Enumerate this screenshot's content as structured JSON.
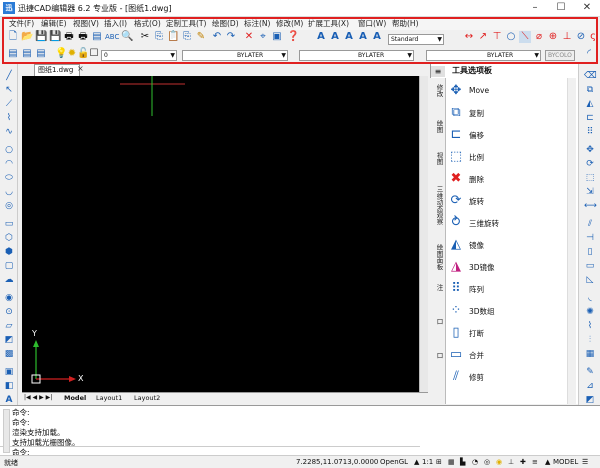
{
  "window": {
    "title": "迅捷CAD编辑器 6.2 专业版 - [图纸1.dwg]",
    "app_icon": "迅",
    "minimize": "–",
    "maximize": "☐",
    "close": "✕"
  },
  "menu": [
    "文件(F)",
    "编辑(E)",
    "视图(V)",
    "插入(I)",
    "格式(O)",
    "定制工具(T)",
    "绘图(D)",
    "标注(N)",
    "修改(M)",
    "扩展工具(X)",
    "窗口(W)",
    "帮助(H)"
  ],
  "toolbar": {
    "text_style": "Standard",
    "layer": "0",
    "color": "BYLATER",
    "linetype": "BYLATER",
    "lineweight": "BYLATER",
    "plotstyle": "BYCOLO"
  },
  "document": {
    "tab_label": "图纸1.dwg",
    "close": "×"
  },
  "axes": {
    "y_label": "Y",
    "x_label": "X"
  },
  "layout_tabs": [
    "Model",
    "Layout1",
    "Layout2"
  ],
  "palette": {
    "title": "工具选项板",
    "tabs": [
      "修改",
      "绘图",
      "视图",
      "三维动态观察",
      "绘图面板",
      "注",
      "口",
      "口"
    ],
    "items": [
      {
        "label": "Move",
        "icon": "move-icon"
      },
      {
        "label": "复制",
        "icon": "copy-icon"
      },
      {
        "label": "偏移",
        "icon": "offset-icon"
      },
      {
        "label": "比例",
        "icon": "scale-icon"
      },
      {
        "label": "删除",
        "icon": "delete-icon"
      },
      {
        "label": "旋转",
        "icon": "rotate-icon"
      },
      {
        "label": "三维旋转",
        "icon": "rotate3d-icon"
      },
      {
        "label": "镜像",
        "icon": "mirror-icon"
      },
      {
        "label": "3D镜像",
        "icon": "mirror3d-icon"
      },
      {
        "label": "阵列",
        "icon": "array-icon"
      },
      {
        "label": "3D数组",
        "icon": "array3d-icon"
      },
      {
        "label": "打断",
        "icon": "break-icon"
      },
      {
        "label": "合并",
        "icon": "join-icon"
      },
      {
        "label": "修剪",
        "icon": "trim-icon"
      }
    ]
  },
  "command": {
    "lines": [
      "命令:",
      "命令:",
      "渲染支持加载。",
      "支持加载光栅图像。"
    ],
    "prompt": "命令:"
  },
  "status": {
    "left": "就绪",
    "coords": "7.2285,11.0713,0.0000",
    "opengl": "OpenGL",
    "scale": "1:1",
    "model": "MODEL"
  }
}
